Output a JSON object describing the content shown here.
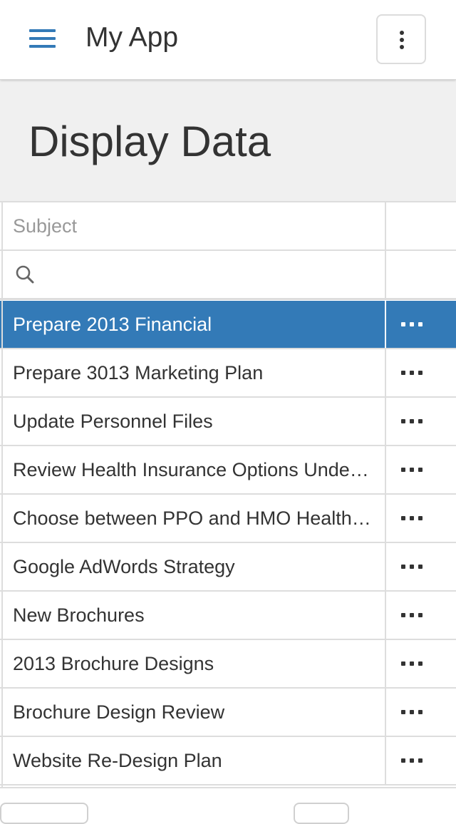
{
  "header": {
    "app_title": "My App",
    "menu_icon": "hamburger-menu-icon",
    "overflow_icon": "vertical-ellipsis-icon"
  },
  "page": {
    "title": "Display Data"
  },
  "grid": {
    "column_header": "Subject",
    "search_icon": "search-icon",
    "search_value": "",
    "row_action_icon": "horizontal-ellipsis-icon",
    "rows": [
      {
        "subject": "Prepare 2013 Financial",
        "selected": true
      },
      {
        "subject": "Prepare 3013 Marketing Plan",
        "selected": false
      },
      {
        "subject": "Update Personnel Files",
        "selected": false
      },
      {
        "subject": "Review Health Insurance Options Under the Affordable Care Act",
        "selected": false
      },
      {
        "subject": "Choose between PPO and HMO Health Plan",
        "selected": false
      },
      {
        "subject": "Google AdWords Strategy",
        "selected": false
      },
      {
        "subject": "New Brochures",
        "selected": false
      },
      {
        "subject": "2013 Brochure Designs",
        "selected": false
      },
      {
        "subject": "Brochure Design Review",
        "selected": false
      },
      {
        "subject": "Website Re-Design Plan",
        "selected": false
      }
    ]
  },
  "colors": {
    "accent": "#337ab7",
    "title_band": "#f0f0f0",
    "grid_border": "#dddddd",
    "text": "#333333",
    "placeholder_text": "#999999"
  }
}
